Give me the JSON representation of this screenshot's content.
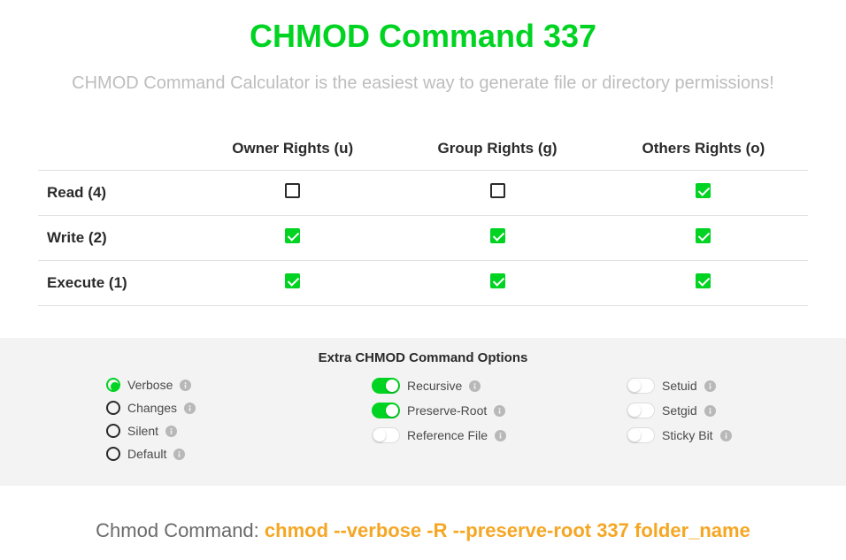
{
  "title": "CHMOD Command 337",
  "subtitle": "CHMOD Command Calculator is the easiest way to generate file or directory permissions!",
  "columns": {
    "owner": "Owner Rights (u)",
    "group": "Group Rights (g)",
    "others": "Others Rights (o)"
  },
  "rows": {
    "read": "Read (4)",
    "write": "Write (2)",
    "execute": "Execute (1)"
  },
  "permissions": {
    "read": {
      "owner": false,
      "group": false,
      "others": true
    },
    "write": {
      "owner": true,
      "group": true,
      "others": true
    },
    "execute": {
      "owner": true,
      "group": true,
      "others": true
    }
  },
  "extra": {
    "title": "Extra CHMOD Command Options",
    "radios": [
      {
        "key": "verbose",
        "label": "Verbose",
        "selected": true
      },
      {
        "key": "changes",
        "label": "Changes",
        "selected": false
      },
      {
        "key": "silent",
        "label": "Silent",
        "selected": false
      },
      {
        "key": "default",
        "label": "Default",
        "selected": false
      }
    ],
    "toggles_mid": [
      {
        "key": "recursive",
        "label": "Recursive",
        "on": true
      },
      {
        "key": "preserve_root",
        "label": "Preserve-Root",
        "on": true
      },
      {
        "key": "reference_file",
        "label": "Reference File",
        "on": false
      }
    ],
    "toggles_right": [
      {
        "key": "setuid",
        "label": "Setuid",
        "on": false
      },
      {
        "key": "setgid",
        "label": "Setgid",
        "on": false
      },
      {
        "key": "sticky_bit",
        "label": "Sticky Bit",
        "on": false
      }
    ]
  },
  "command": {
    "label": "Chmod Command: ",
    "value": "chmod --verbose -R --preserve-root 337 folder_name"
  }
}
